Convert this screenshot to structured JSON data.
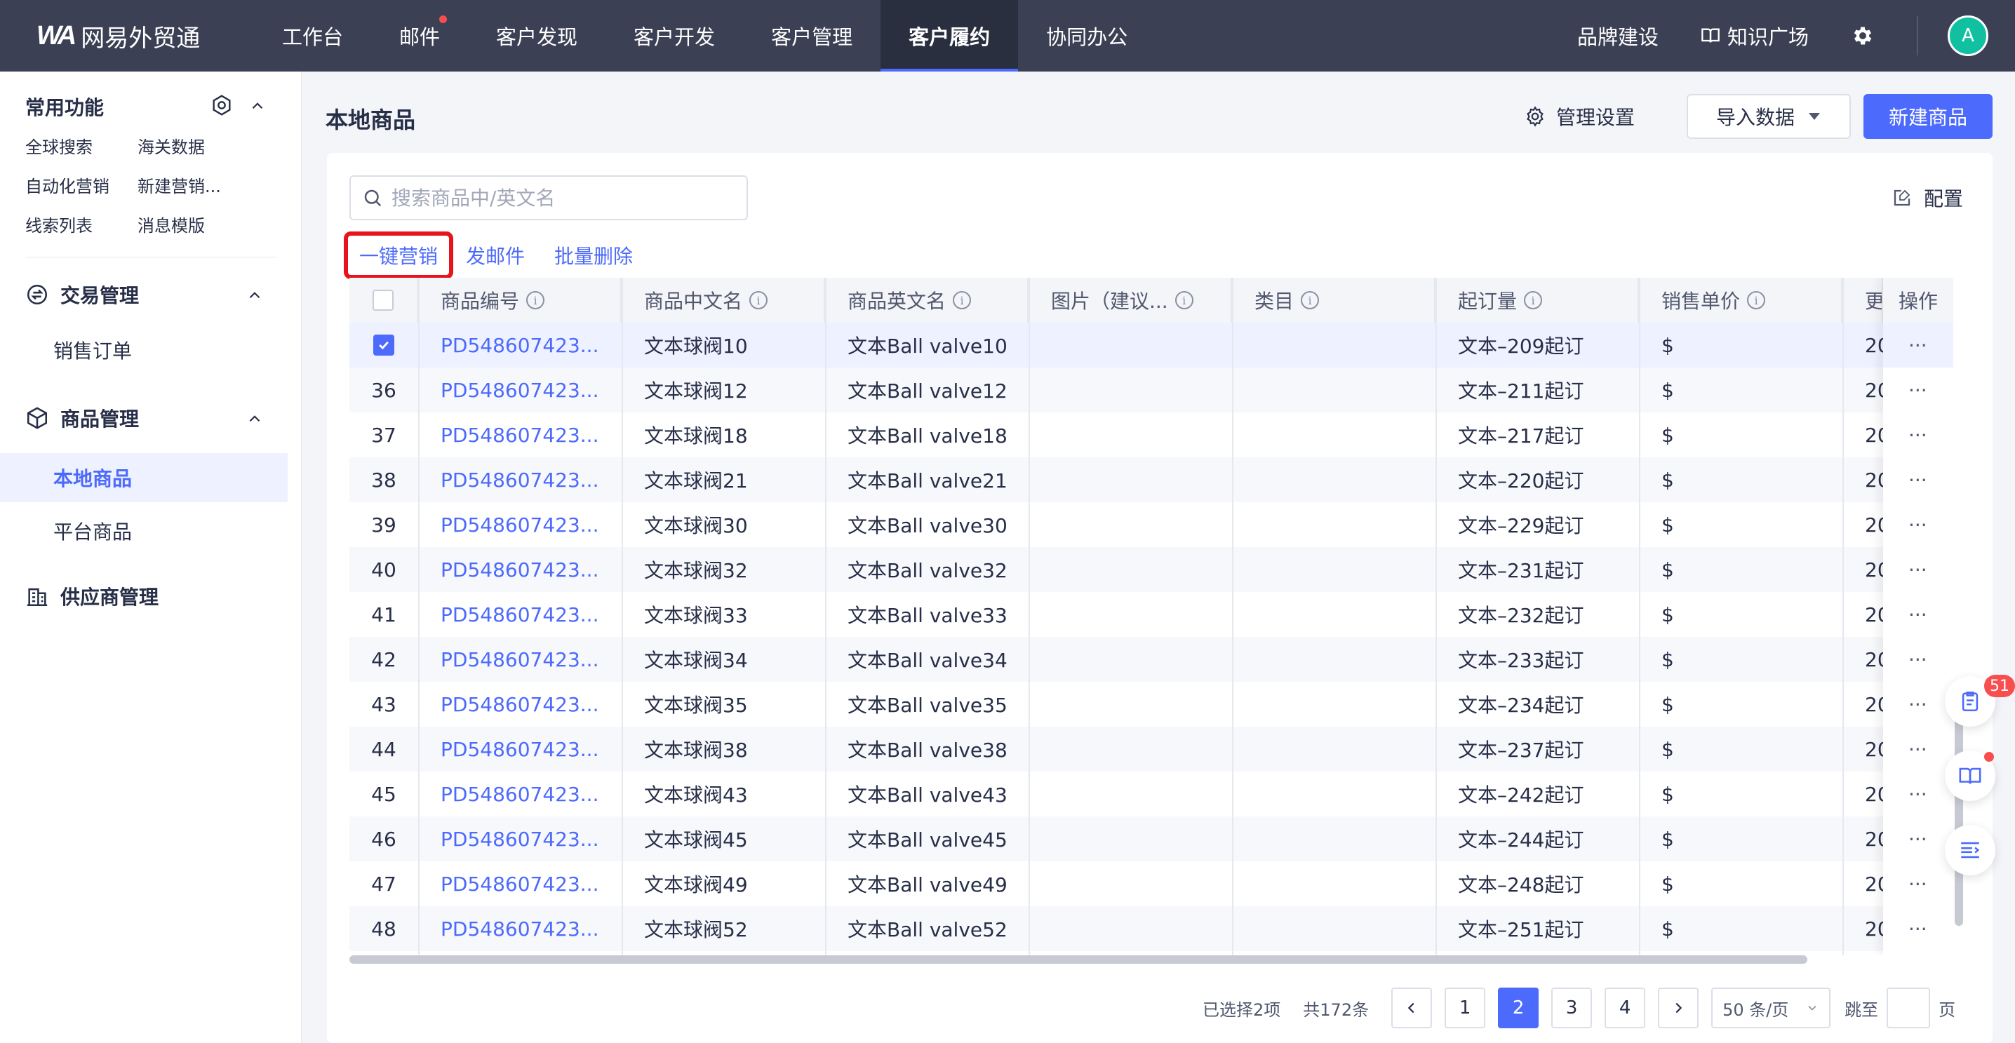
{
  "topbar": {
    "brand": "网易外贸通",
    "nav": [
      "工作台",
      "邮件",
      "客户发现",
      "客户开发",
      "客户管理",
      "客户履约",
      "协同办公"
    ],
    "active_nav_index": 5,
    "mail_has_dot": true,
    "brand_build": "品牌建设",
    "knowledge": "知识广场",
    "avatar_initial": "A"
  },
  "sidebar": {
    "common_title": "常用功能",
    "common_links": [
      "全球搜索",
      "海关数据",
      "自动化营销",
      "新建营销...",
      "线索列表",
      "消息模版"
    ],
    "groups": {
      "trade": "交易管理",
      "trade_items": [
        "销售订单"
      ],
      "goods": "商品管理",
      "goods_items": [
        "本地商品",
        "平台商品"
      ],
      "supplier": "供应商管理"
    }
  },
  "main": {
    "title": "本地商品",
    "manage_settings": "管理设置",
    "import_data": "导入数据",
    "new_goods": "新建商品",
    "search_placeholder": "搜索商品中/英文名",
    "config": "配置",
    "bulk_actions": [
      "一键营销",
      "发邮件",
      "批量删除"
    ]
  },
  "table": {
    "headers": [
      "商品编号",
      "商品中文名",
      "商品英文名",
      "图片（建议...",
      "类目",
      "起订量",
      "销售单价",
      "更"
    ],
    "op_header": "操作",
    "rows": [
      {
        "no": "",
        "checked": true,
        "code": "PD548607423...",
        "cn": "文本球阀10",
        "en": "文本Ball valve10",
        "moq": "文本–209起订",
        "price": "$",
        "upd": "20"
      },
      {
        "no": "36",
        "checked": false,
        "code": "PD548607423...",
        "cn": "文本球阀12",
        "en": "文本Ball valve12",
        "moq": "文本–211起订",
        "price": "$",
        "upd": "20"
      },
      {
        "no": "37",
        "checked": false,
        "code": "PD548607423...",
        "cn": "文本球阀18",
        "en": "文本Ball valve18",
        "moq": "文本–217起订",
        "price": "$",
        "upd": "20"
      },
      {
        "no": "38",
        "checked": false,
        "code": "PD548607423...",
        "cn": "文本球阀21",
        "en": "文本Ball valve21",
        "moq": "文本–220起订",
        "price": "$",
        "upd": "20"
      },
      {
        "no": "39",
        "checked": false,
        "code": "PD548607423...",
        "cn": "文本球阀30",
        "en": "文本Ball valve30",
        "moq": "文本–229起订",
        "price": "$",
        "upd": "20"
      },
      {
        "no": "40",
        "checked": false,
        "code": "PD548607423...",
        "cn": "文本球阀32",
        "en": "文本Ball valve32",
        "moq": "文本–231起订",
        "price": "$",
        "upd": "20"
      },
      {
        "no": "41",
        "checked": false,
        "code": "PD548607423...",
        "cn": "文本球阀33",
        "en": "文本Ball valve33",
        "moq": "文本–232起订",
        "price": "$",
        "upd": "20"
      },
      {
        "no": "42",
        "checked": false,
        "code": "PD548607423...",
        "cn": "文本球阀34",
        "en": "文本Ball valve34",
        "moq": "文本–233起订",
        "price": "$",
        "upd": "20"
      },
      {
        "no": "43",
        "checked": false,
        "code": "PD548607423...",
        "cn": "文本球阀35",
        "en": "文本Ball valve35",
        "moq": "文本–234起订",
        "price": "$",
        "upd": "20"
      },
      {
        "no": "44",
        "checked": false,
        "code": "PD548607423...",
        "cn": "文本球阀38",
        "en": "文本Ball valve38",
        "moq": "文本–237起订",
        "price": "$",
        "upd": "20"
      },
      {
        "no": "45",
        "checked": false,
        "code": "PD548607423...",
        "cn": "文本球阀43",
        "en": "文本Ball valve43",
        "moq": "文本–242起订",
        "price": "$",
        "upd": "20"
      },
      {
        "no": "46",
        "checked": false,
        "code": "PD548607423...",
        "cn": "文本球阀45",
        "en": "文本Ball valve45",
        "moq": "文本–244起订",
        "price": "$",
        "upd": "20"
      },
      {
        "no": "47",
        "checked": false,
        "code": "PD548607423...",
        "cn": "文本球阀49",
        "en": "文本Ball valve49",
        "moq": "文本–248起订",
        "price": "$",
        "upd": "20"
      },
      {
        "no": "48",
        "checked": false,
        "code": "PD548607423...",
        "cn": "文本球阀52",
        "en": "文本Ball valve52",
        "moq": "文本–251起订",
        "price": "$",
        "upd": "20"
      }
    ],
    "op_label": "···"
  },
  "pagination": {
    "selected": "已选择2项",
    "total": "共172条",
    "pages": [
      "1",
      "2",
      "3",
      "4"
    ],
    "current_page": "2",
    "page_size": "50 条/页",
    "jump_to": "跳至",
    "page_unit": "页"
  },
  "floating": {
    "todo_badge": "51"
  },
  "colors": {
    "topbar": "#3b4054",
    "accent": "#4c6afc",
    "highlight": "#e8141b"
  }
}
